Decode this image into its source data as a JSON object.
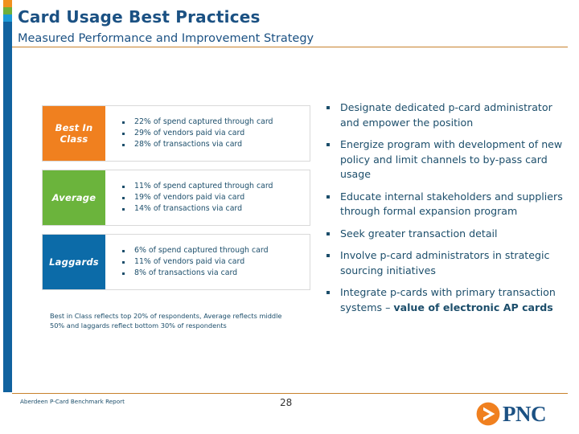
{
  "header": {
    "title": "Card Usage Best Practices",
    "subtitle": "Measured Performance and Improvement Strategy"
  },
  "colors": {
    "best_in_class": "#F0801F",
    "average": "#6BB43C",
    "laggards": "#0C6BA8",
    "title_blue": "#1B5183",
    "rule_orange": "#C8812C",
    "body_text": "#1C4E6B"
  },
  "edge_bar": {
    "segments": [
      "orange",
      "green",
      "cyan",
      "blue"
    ]
  },
  "table": {
    "rows": [
      {
        "label": "Best In Class",
        "label_line1": "Best In",
        "label_line2": "Class",
        "color": "#F0801F",
        "bullets": [
          "22% of spend captured through card",
          "29% of vendors paid via card",
          "28% of transactions via card"
        ]
      },
      {
        "label": "Average",
        "label_line1": "Average",
        "label_line2": "",
        "color": "#6BB43C",
        "bullets": [
          "11% of spend captured through card",
          "19% of vendors paid via card",
          "14% of transactions via card"
        ]
      },
      {
        "label": "Laggards",
        "label_line1": "Laggards",
        "label_line2": "",
        "color": "#0C6BA8",
        "bullets": [
          "6% of spend captured through card",
          "11% of vendors paid via card",
          "8% of transactions via card"
        ]
      }
    ]
  },
  "footnote": "Best in Class reflects top 20% of respondents, Average reflects middle 50% and laggards reflect bottom 30% of respondents",
  "recommendations": {
    "items": [
      {
        "text": "Designate dedicated p-card administrator and empower the position",
        "bold": ""
      },
      {
        "text": "Energize program with development of new policy and limit channels to by-pass card usage",
        "bold": ""
      },
      {
        "text": "Educate internal stakeholders and suppliers through formal expansion program",
        "bold": ""
      },
      {
        "text": "Seek greater transaction detail",
        "bold": ""
      },
      {
        "text": "Involve p-card administrators in strategic sourcing initiatives",
        "bold": ""
      },
      {
        "text": "Integrate p-cards with primary transaction systems – ",
        "bold": "value of electronic AP cards"
      }
    ]
  },
  "footer": {
    "source": "Aberdeen P-Card Benchmark Report",
    "page_number": "28",
    "logo_text": "PNC",
    "logo_icon": "pnc-arrow-icon"
  }
}
